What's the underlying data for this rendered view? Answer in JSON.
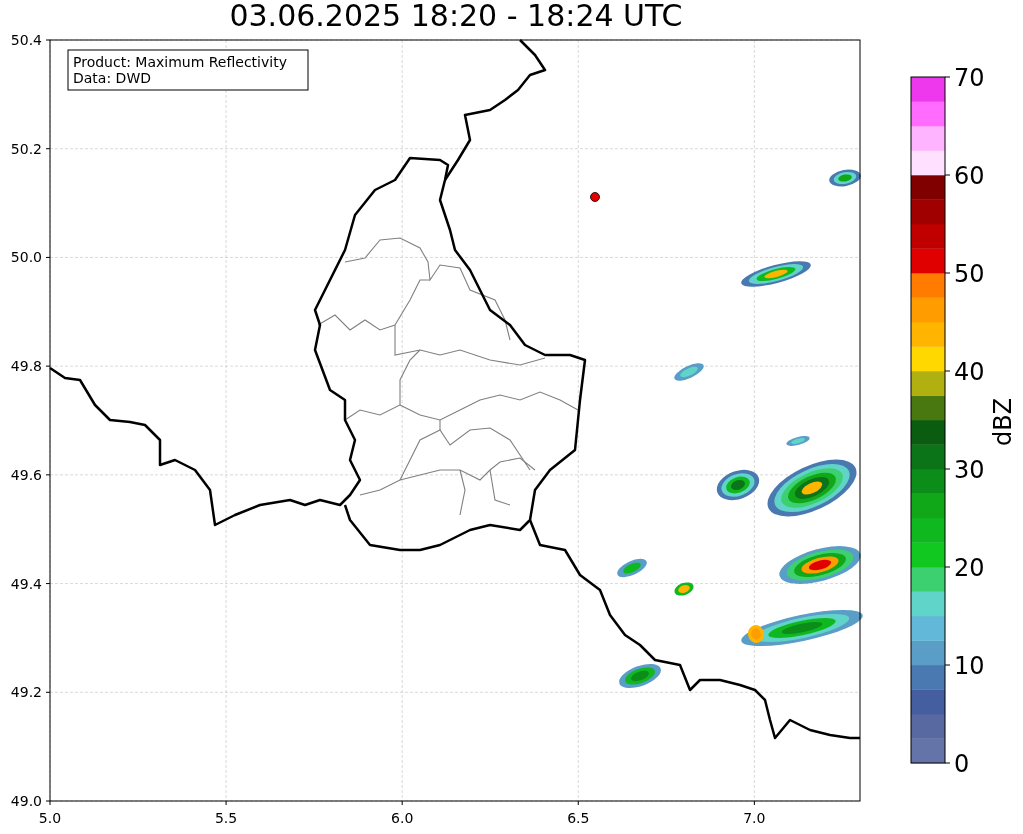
{
  "title": "03.06.2025 18:20 - 18:24 UTC",
  "info_box": {
    "lines": [
      "Product: Maximum Reflectivity",
      "Data: DWD"
    ]
  },
  "map": {
    "xticks": [
      "5.0",
      "5.5",
      "6.0",
      "6.5",
      "7.0"
    ],
    "yticks": [
      "50.4",
      "50.2",
      "50.0",
      "49.8",
      "49.6",
      "49.4",
      "49.2",
      "49.0"
    ]
  },
  "colorbar": {
    "label": "dBZ",
    "ticks": [
      "70",
      "60",
      "50",
      "40",
      "30",
      "20",
      "10",
      "0"
    ],
    "bins": [
      {
        "color": "#6474a8"
      },
      {
        "color": "#5868a0"
      },
      {
        "color": "#445ea0"
      },
      {
        "color": "#4a78b0"
      },
      {
        "color": "#5a9ec8"
      },
      {
        "color": "#62b8d8"
      },
      {
        "color": "#60d4c8"
      },
      {
        "color": "#3cd070"
      },
      {
        "color": "#10c820"
      },
      {
        "color": "#10b820"
      },
      {
        "color": "#10a818"
      },
      {
        "color": "#0c8c18"
      },
      {
        "color": "#0c7418"
      },
      {
        "color": "#0a5c10"
      },
      {
        "color": "#4a7810"
      },
      {
        "color": "#b0b010"
      },
      {
        "color": "#ffd800"
      },
      {
        "color": "#ffb400"
      },
      {
        "color": "#ff9c00"
      },
      {
        "color": "#ff7c00"
      },
      {
        "color": "#e00000"
      },
      {
        "color": "#c00000"
      },
      {
        "color": "#a00000"
      },
      {
        "color": "#800000"
      },
      {
        "color": "#ffe0ff"
      },
      {
        "color": "#ffb4ff"
      },
      {
        "color": "#ff6cff"
      },
      {
        "color": "#ee38ee"
      }
    ]
  }
}
